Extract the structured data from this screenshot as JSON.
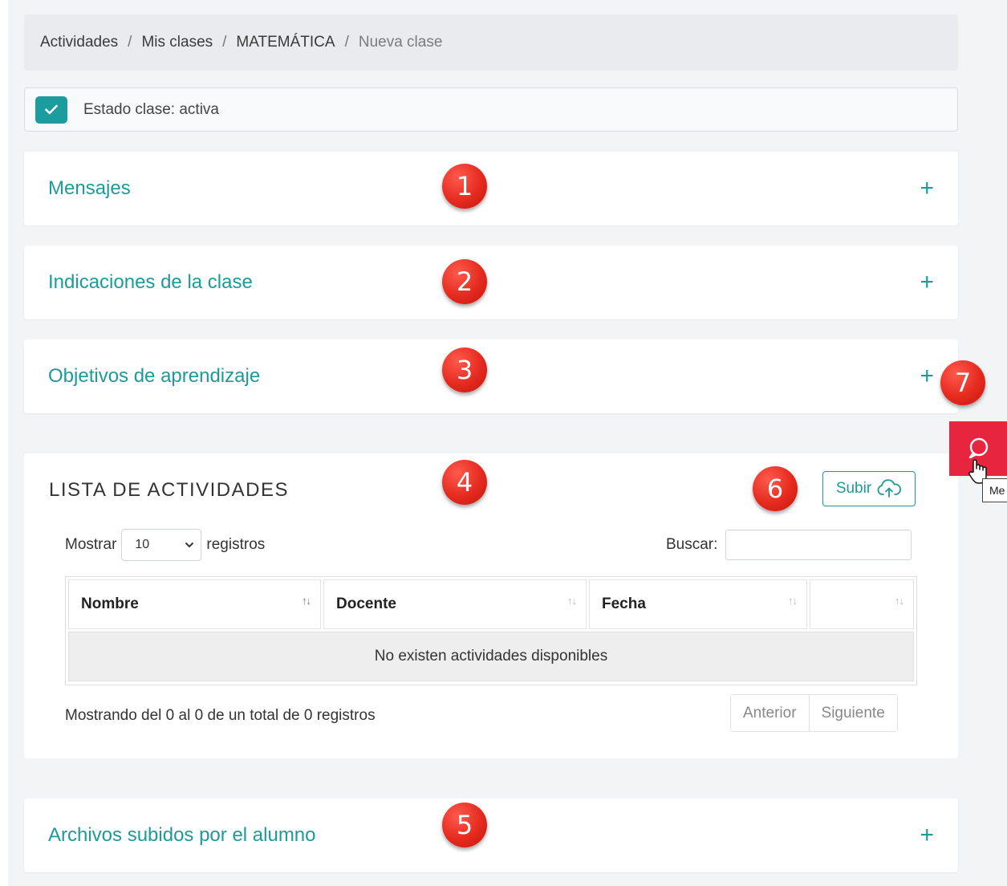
{
  "breadcrumb": {
    "items": [
      "Actividades",
      "Mis clases",
      "MATEMÁTICA"
    ],
    "current": "Nueva clase",
    "separator": "/"
  },
  "estado": {
    "label": "Estado clase: activa",
    "checked": true
  },
  "sections": {
    "mensajes": "Mensajes",
    "indicaciones": "Indicaciones de la clase",
    "objetivos": "Objetivos de aprendizaje",
    "archivos": "Archivos subidos por el alumno",
    "plus": "+"
  },
  "actividades": {
    "title": "LISTA DE ACTIVIDADES",
    "upload_label": "Subir",
    "show_label": "Mostrar",
    "page_size": "10",
    "records_label": "registros",
    "search_label": "Buscar:",
    "search_value": "",
    "columns": [
      "Nombre",
      "Docente",
      "Fecha",
      ""
    ],
    "sort_glyph": "↑↓",
    "empty_message": "No existen actividades disponibles",
    "info": "Mostrando del 0 al 0 de un total de 0 registros",
    "prev_label": "Anterior",
    "next_label": "Siguiente"
  },
  "badges": [
    "1",
    "2",
    "3",
    "4",
    "5",
    "6",
    "7"
  ],
  "chat": {
    "tooltip": "Me"
  },
  "colors": {
    "accent": "#1d9a9a",
    "badge": "#e52a1f",
    "chat": "#e8253f"
  }
}
